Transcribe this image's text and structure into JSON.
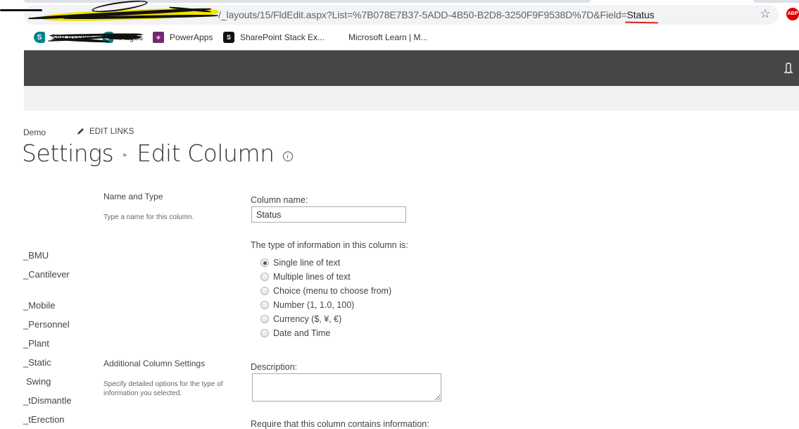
{
  "browser": {
    "url_visible": "/_layouts/15/FldEdit.aspx?List=%7B078E7B37-5ADD-4B50-B2D8-3250F9F9538D%7D&Field=",
    "url_field_value": "Status",
    "bookmark_icon": "star-icon",
    "extension_label": "ABP",
    "bookmarks": [
      {
        "label": "Site Assets",
        "icon": "sharepoint-icon",
        "redacted": true
      },
      {
        "label": "Pages",
        "icon": "sharepoint-icon",
        "redacted": true
      },
      {
        "label": "PowerApps",
        "icon": "powerapps-icon"
      },
      {
        "label": "SharePoint Stack Ex...",
        "icon": "stackexchange-icon"
      },
      {
        "label": "Microsoft Learn | M...",
        "icon": "microsoft-icon"
      }
    ]
  },
  "suitebar": {
    "notification_icon": "bell-icon"
  },
  "topnav": {
    "site_crumb": "Demo",
    "edit_links": "EDIT LINKS"
  },
  "page": {
    "breadcrumb_parent": "Settings",
    "title": "Edit Column",
    "info_icon": "i"
  },
  "leftnav": {
    "items": [
      "_BMU",
      "_Cantilever",
      "_Mobile",
      "_Personnel",
      "_Plant",
      "_Static",
      "Swing",
      "_tDismantle",
      "_tErection"
    ]
  },
  "form": {
    "name_section": {
      "title": "Name and Type",
      "description": "Type a name for this column."
    },
    "column_name_label": "Column name:",
    "column_name_value": "Status",
    "type_label": "The type of information in this column is:",
    "types": [
      {
        "label": "Single line of text",
        "checked": true
      },
      {
        "label": "Multiple lines of text",
        "checked": false
      },
      {
        "label": "Choice (menu to choose from)",
        "checked": false
      },
      {
        "label": "Number (1, 1.0, 100)",
        "checked": false
      },
      {
        "label": "Currency ($, ¥, €)",
        "checked": false
      },
      {
        "label": "Date and Time",
        "checked": false
      }
    ],
    "additional_section": {
      "title": "Additional Column Settings",
      "description": "Specify detailed options for the type of information you selected."
    },
    "description_label": "Description:",
    "description_value": "",
    "require_label": "Require that this column contains information:"
  }
}
